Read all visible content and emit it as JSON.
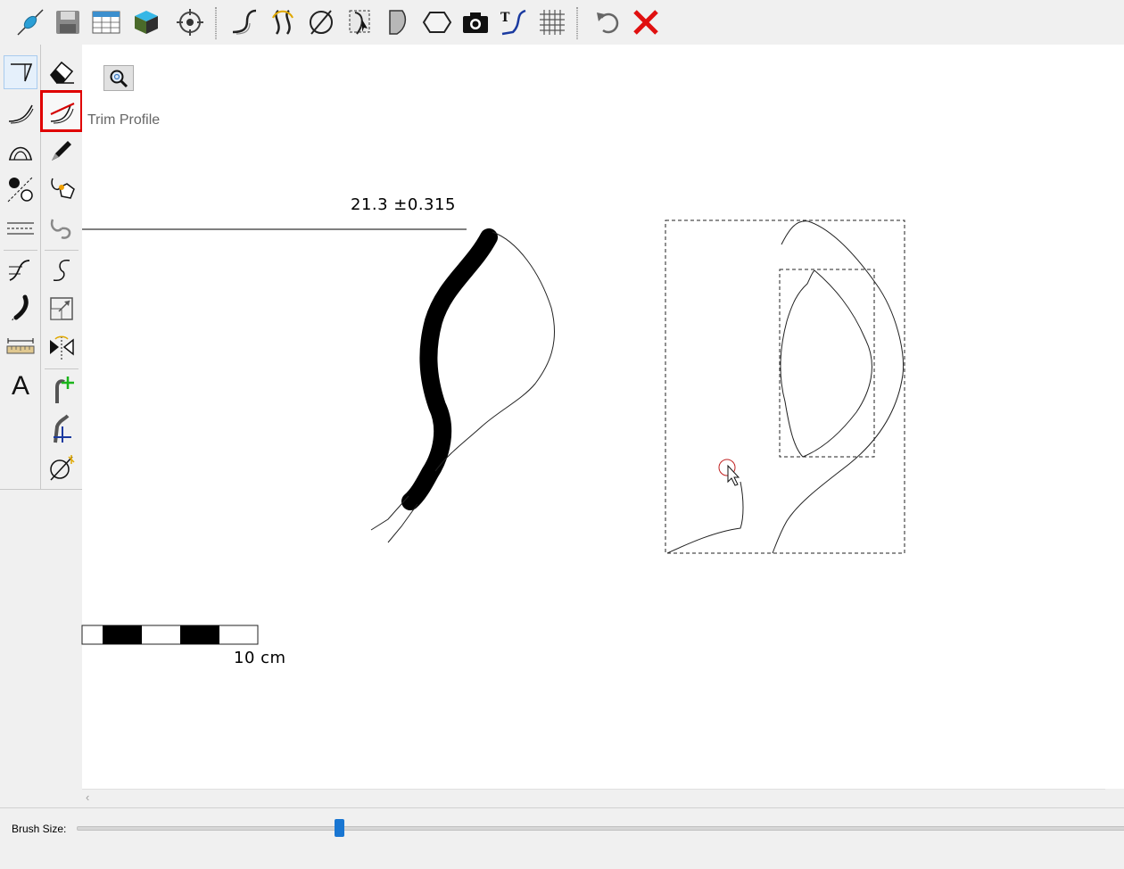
{
  "toolbar": {
    "buttons": [
      {
        "name": "connect-icon"
      },
      {
        "name": "save-icon"
      },
      {
        "name": "table-icon"
      },
      {
        "name": "3d-box-icon"
      },
      {
        "name": "target-icon"
      },
      {
        "name": "profile-curve-icon"
      },
      {
        "name": "rotate-profile-icon"
      },
      {
        "name": "diameter-icon"
      },
      {
        "name": "select-profile-icon"
      },
      {
        "name": "half-profile-icon"
      },
      {
        "name": "polygon-icon"
      },
      {
        "name": "camera-icon"
      },
      {
        "name": "text-profile-icon"
      },
      {
        "name": "grid-icon"
      },
      {
        "name": "undo-icon"
      },
      {
        "name": "close-icon"
      }
    ]
  },
  "tools": {
    "left": [
      "outline-tool-icon",
      "curve-tool-icon",
      "arch-tool-icon",
      "points-tool-icon",
      "dashed-lines-icon",
      "profile-lines-icon",
      "brush-curve-icon",
      "ruler-icon",
      "text-tool-icon"
    ],
    "right": [
      "eraser-icon",
      "trim-profile-icon",
      "pencil-icon",
      "handle-icon",
      "handle-gray-icon",
      "s-curve-icon",
      "scale-box-icon",
      "mirror-icon",
      "add-point-icon",
      "blue-point-icon",
      "diameter-tool-icon"
    ],
    "text_tool_glyph": "A",
    "highlighted_tooltip": "Trim Profile"
  },
  "canvas": {
    "measurement": "21.3 ±0.315",
    "scale_label": "10 cm"
  },
  "bottom": {
    "brush_label": "Brush Size:",
    "brush_value": 0.25
  },
  "colors": {
    "highlight": "#e00000",
    "slider": "#1976d2",
    "close_red": "#e01010"
  }
}
